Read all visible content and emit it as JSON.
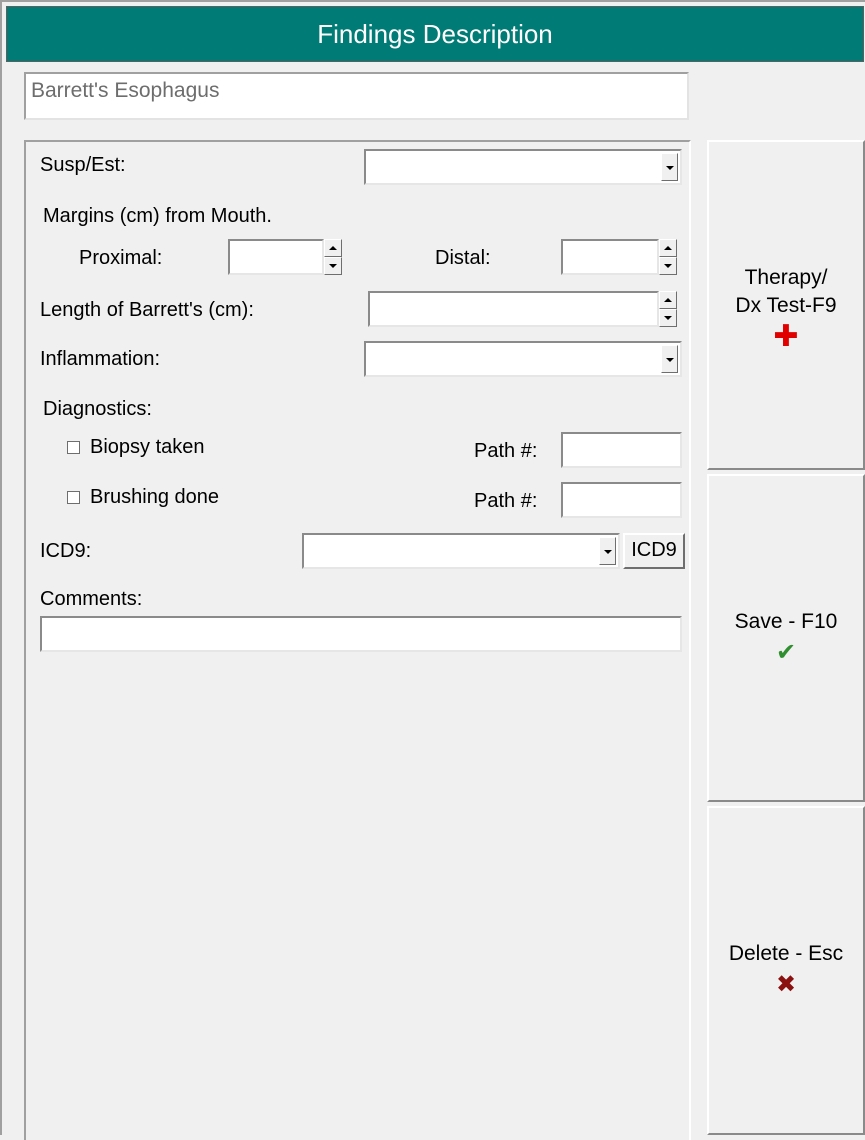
{
  "header": {
    "title": "Findings Description"
  },
  "finding": {
    "name": "Barrett's Esophagus"
  },
  "form": {
    "susp_est_label": "Susp/Est:",
    "susp_est_value": "",
    "margins_label": "Margins (cm) from Mouth.",
    "proximal_label": "Proximal:",
    "proximal_value": "",
    "distal_label": "Distal:",
    "distal_value": "",
    "length_label": "Length of Barrett's (cm):",
    "length_value": "",
    "inflammation_label": "Inflammation:",
    "inflammation_value": "",
    "diagnostics_label": "Diagnostics:",
    "biopsy_label": "Biopsy taken",
    "biopsy_checked": false,
    "biopsy_path_label": "Path #:",
    "biopsy_path_value": "",
    "brushing_label": "Brushing done",
    "brushing_checked": false,
    "brushing_path_label": "Path #:",
    "brushing_path_value": "",
    "icd9_label": "ICD9:",
    "icd9_value": "",
    "icd9_button": "ICD9",
    "comments_label": "Comments:",
    "comments_value": ""
  },
  "actions": {
    "therapy_line1": "Therapy/",
    "therapy_line2": "Dx Test-F9",
    "therapy_icon": "plus-icon",
    "save_label": "Save - F10",
    "save_icon": "check-icon",
    "delete_label": "Delete - Esc",
    "delete_icon": "x-icon"
  },
  "colors": {
    "title_bar": "#007b75",
    "plus": "#e10000",
    "check": "#2f8f2f",
    "cross": "#8b1010"
  }
}
